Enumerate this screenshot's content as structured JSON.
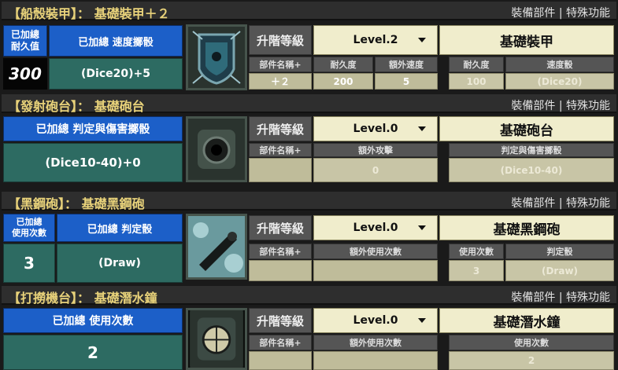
{
  "sections": [
    {
      "title": "【船殼裝甲】： 基礎裝甲＋２",
      "links": "裝備部件 | 特殊功能",
      "stat_label": "已加總\n耐久值",
      "stat_value": "300",
      "formula_label": "已加總  速度擲骰",
      "formula_value": "(Dice20)+5",
      "upgrade_label": "升階等級",
      "level": "Level.2",
      "part_name": "基礎裝甲",
      "left_headers": [
        "部件名稱+",
        "耐久度",
        "額外速度"
      ],
      "left_values": [
        "＋２",
        "200",
        "5"
      ],
      "right_headers": [
        "耐久度",
        "速度骰"
      ],
      "right_values": [
        "100",
        "(Dice20)"
      ]
    },
    {
      "title": "【發射砲台】： 基礎砲台",
      "links": "裝備部件 | 特殊功能",
      "formula_label": "已加總  判定與傷害擲骰",
      "formula_value": "(Dice10-40)+0",
      "upgrade_label": "升階等級",
      "level": "Level.0",
      "part_name": "基礎砲台",
      "left_headers": [
        "部件名稱+",
        "額外攻擊"
      ],
      "left_values": [
        "",
        "0"
      ],
      "right_headers": [
        "判定與傷害擲骰"
      ],
      "right_values": [
        "(Dice10-40)"
      ]
    },
    {
      "title": "【黑鋼砲】： 基礎黑鋼砲",
      "links": "裝備部件 | 特殊功能",
      "stat_label": "已加總\n使用次數",
      "stat_value": "3",
      "formula_label": "已加總  判定骰",
      "formula_value": "(Draw)",
      "upgrade_label": "升階等級",
      "level": "Level.0",
      "part_name": "基礎黑鋼砲",
      "left_headers": [
        "部件名稱+",
        "額外使用次數"
      ],
      "left_values": [
        "",
        ""
      ],
      "right_headers": [
        "使用次數",
        "判定骰"
      ],
      "right_values": [
        "3",
        "(Draw)"
      ]
    },
    {
      "title": "【打撈機台】： 基礎潛水鐘",
      "links": "裝備部件 | 特殊功能",
      "formula_label": "已加總  使用次數",
      "formula_value": "2",
      "upgrade_label": "升階等級",
      "level": "Level.0",
      "part_name": "基礎潛水鐘",
      "left_headers": [
        "部件名稱+",
        "額外使用次數"
      ],
      "left_values": [
        "",
        ""
      ],
      "right_headers": [
        "使用次數"
      ],
      "right_values": [
        "2"
      ]
    }
  ],
  "icons": [
    "armor-icon",
    "cannon-icon",
    "black-steel-cannon-icon",
    "diving-bell-icon"
  ]
}
